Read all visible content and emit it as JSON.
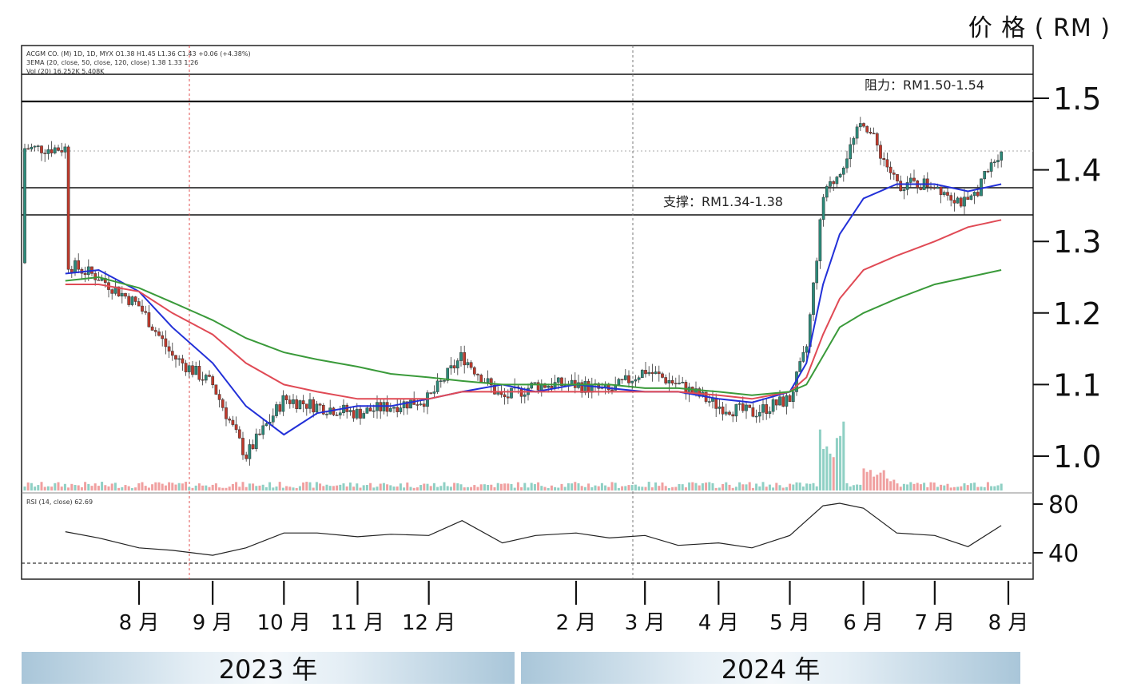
{
  "chart_data": {
    "type": "line",
    "ylabel": "价 格 ( RM )",
    "y_ticks": [
      1.5,
      1.4,
      1.3,
      1.2,
      1.1,
      1.0
    ],
    "y_tick_labels": [
      "1.5",
      "1.4",
      "1.3",
      "1.2",
      "1.1",
      "1.0"
    ],
    "ylim": [
      0.95,
      1.55
    ],
    "x_month_labels": [
      "8 月",
      "9 月",
      "10 月",
      "11 月",
      "12 月",
      "2 月",
      "3 月",
      "4 月",
      "5 月",
      "6 月",
      "7 月",
      "8 月"
    ],
    "years": [
      "2023 年",
      "2024 年"
    ],
    "legend_header": [
      "ACGM CO. (M) 1D, 1D, MYX O1.38 H1.45 L1.36 C1.43 +0.06 (+4.38%)",
      "3EMA (20, close, 50, close, 120, close) 1.38 1.33 1.26",
      "Vol (20) 16.252K 5.408K"
    ],
    "rsi_header": "RSI (14, close) 62.69",
    "annotations": {
      "resistance": "阻力：RM1.50-1.54",
      "support": "支撑：RM1.34-1.38"
    },
    "rsi_ticks": [
      "80",
      "40"
    ],
    "date_x": [
      "2023-07-01",
      "2023-07-15",
      "2023-08-01",
      "2023-08-15",
      "2023-09-01",
      "2023-09-15",
      "2023-10-01",
      "2023-10-15",
      "2023-11-01",
      "2023-11-15",
      "2023-12-01",
      "2023-12-15",
      "2024-01-01",
      "2024-01-15",
      "2024-02-01",
      "2024-02-15",
      "2024-03-01",
      "2024-03-15",
      "2024-04-01",
      "2024-04-15",
      "2024-05-01",
      "2024-05-08",
      "2024-05-15",
      "2024-05-22",
      "2024-06-01",
      "2024-06-15",
      "2024-07-01",
      "2024-07-15",
      "2024-07-29"
    ],
    "series": [
      {
        "name": "EMA 20",
        "color": "#2230d8",
        "values": [
          1.255,
          1.26,
          1.23,
          1.18,
          1.13,
          1.07,
          1.03,
          1.06,
          1.07,
          1.07,
          1.08,
          1.09,
          1.1,
          1.09,
          1.1,
          1.095,
          1.09,
          1.09,
          1.08,
          1.075,
          1.09,
          1.13,
          1.24,
          1.31,
          1.36,
          1.38,
          1.38,
          1.37,
          1.38
        ]
      },
      {
        "name": "EMA 50",
        "color": "#e04a55",
        "values": [
          1.24,
          1.24,
          1.23,
          1.2,
          1.17,
          1.13,
          1.1,
          1.09,
          1.08,
          1.08,
          1.08,
          1.09,
          1.09,
          1.09,
          1.09,
          1.09,
          1.09,
          1.09,
          1.085,
          1.08,
          1.09,
          1.11,
          1.17,
          1.22,
          1.26,
          1.28,
          1.3,
          1.32,
          1.33
        ]
      },
      {
        "name": "EMA 120",
        "color": "#3a9a3a",
        "values": [
          1.245,
          1.25,
          1.235,
          1.215,
          1.19,
          1.165,
          1.145,
          1.135,
          1.125,
          1.115,
          1.11,
          1.105,
          1.1,
          1.1,
          1.1,
          1.1,
          1.095,
          1.095,
          1.09,
          1.085,
          1.09,
          1.1,
          1.14,
          1.18,
          1.2,
          1.22,
          1.24,
          1.25,
          1.26
        ]
      },
      {
        "name": "Close",
        "color": "#555555",
        "values": [
          1.27,
          1.25,
          1.21,
          1.14,
          1.1,
          1.0,
          1.08,
          1.07,
          1.06,
          1.07,
          1.08,
          1.14,
          1.08,
          1.1,
          1.1,
          1.09,
          1.12,
          1.1,
          1.07,
          1.06,
          1.08,
          1.15,
          1.36,
          1.4,
          1.47,
          1.38,
          1.38,
          1.35,
          1.43
        ]
      },
      {
        "name": "RSI",
        "color": "#222222",
        "values": [
          57,
          52,
          44,
          42,
          38,
          44,
          56,
          56,
          53,
          55,
          54,
          66,
          48,
          54,
          56,
          52,
          54,
          46,
          48,
          44,
          54,
          66,
          78,
          80,
          76,
          56,
          54,
          45,
          62
        ]
      }
    ]
  }
}
